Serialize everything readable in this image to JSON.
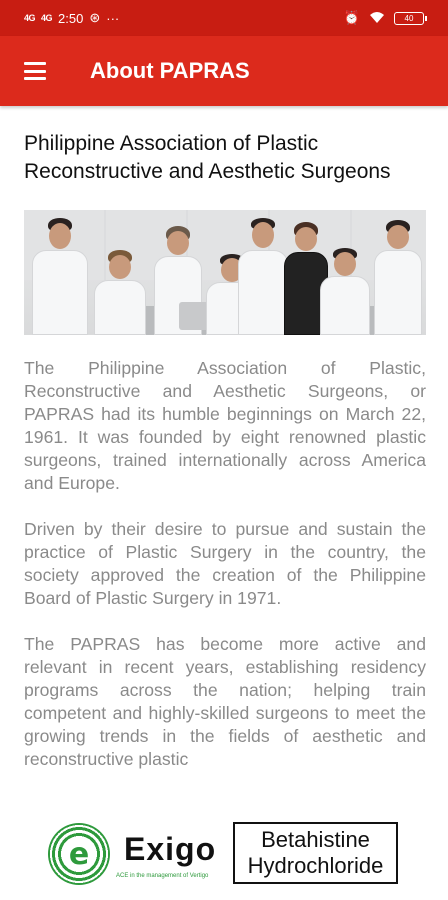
{
  "status_bar": {
    "time": "2:50",
    "signal_1": "4G",
    "signal_2": "4G",
    "more": "···",
    "battery": "40"
  },
  "app_bar": {
    "title": "About PAPRAS",
    "menu_icon": "hamburger-menu-icon"
  },
  "content": {
    "heading": "Philippine Association of Plastic Reconstructive and Aesthetic Surgeons",
    "paragraphs": [
      "The Philippine Association of Plastic, Reconstructive and Aesthetic Surgeons, or PAPRAS had its humble beginnings on March 22, 1961. It was founded by eight renowned plastic surgeons, trained internationally across America and Europe.",
      "Driven by their desire to pursue and sustain the practice of Plastic Surgery in the country, the society approved the creation of the Philippine Board of Plastic Surgery in 1971.",
      "The PAPRAS has become more active and relevant in recent years, establishing residency programs across the nation; helping train competent and highly-skilled surgeons to meet the growing trends in the fields of aesthetic and reconstructive plastic"
    ]
  },
  "banner": {
    "exigo_logo_letter": "e",
    "exigo_name": "Exigo",
    "exigo_tagline": "ACE in the management of Vertigo",
    "drug_line1": "Betahistine",
    "drug_line2": "Hydrochloride"
  },
  "colors": {
    "status_bar": "#c81d12",
    "app_bar": "#dc2a1c",
    "body_text": "#8a8a8a",
    "logo_green": "#2e9a3c"
  }
}
